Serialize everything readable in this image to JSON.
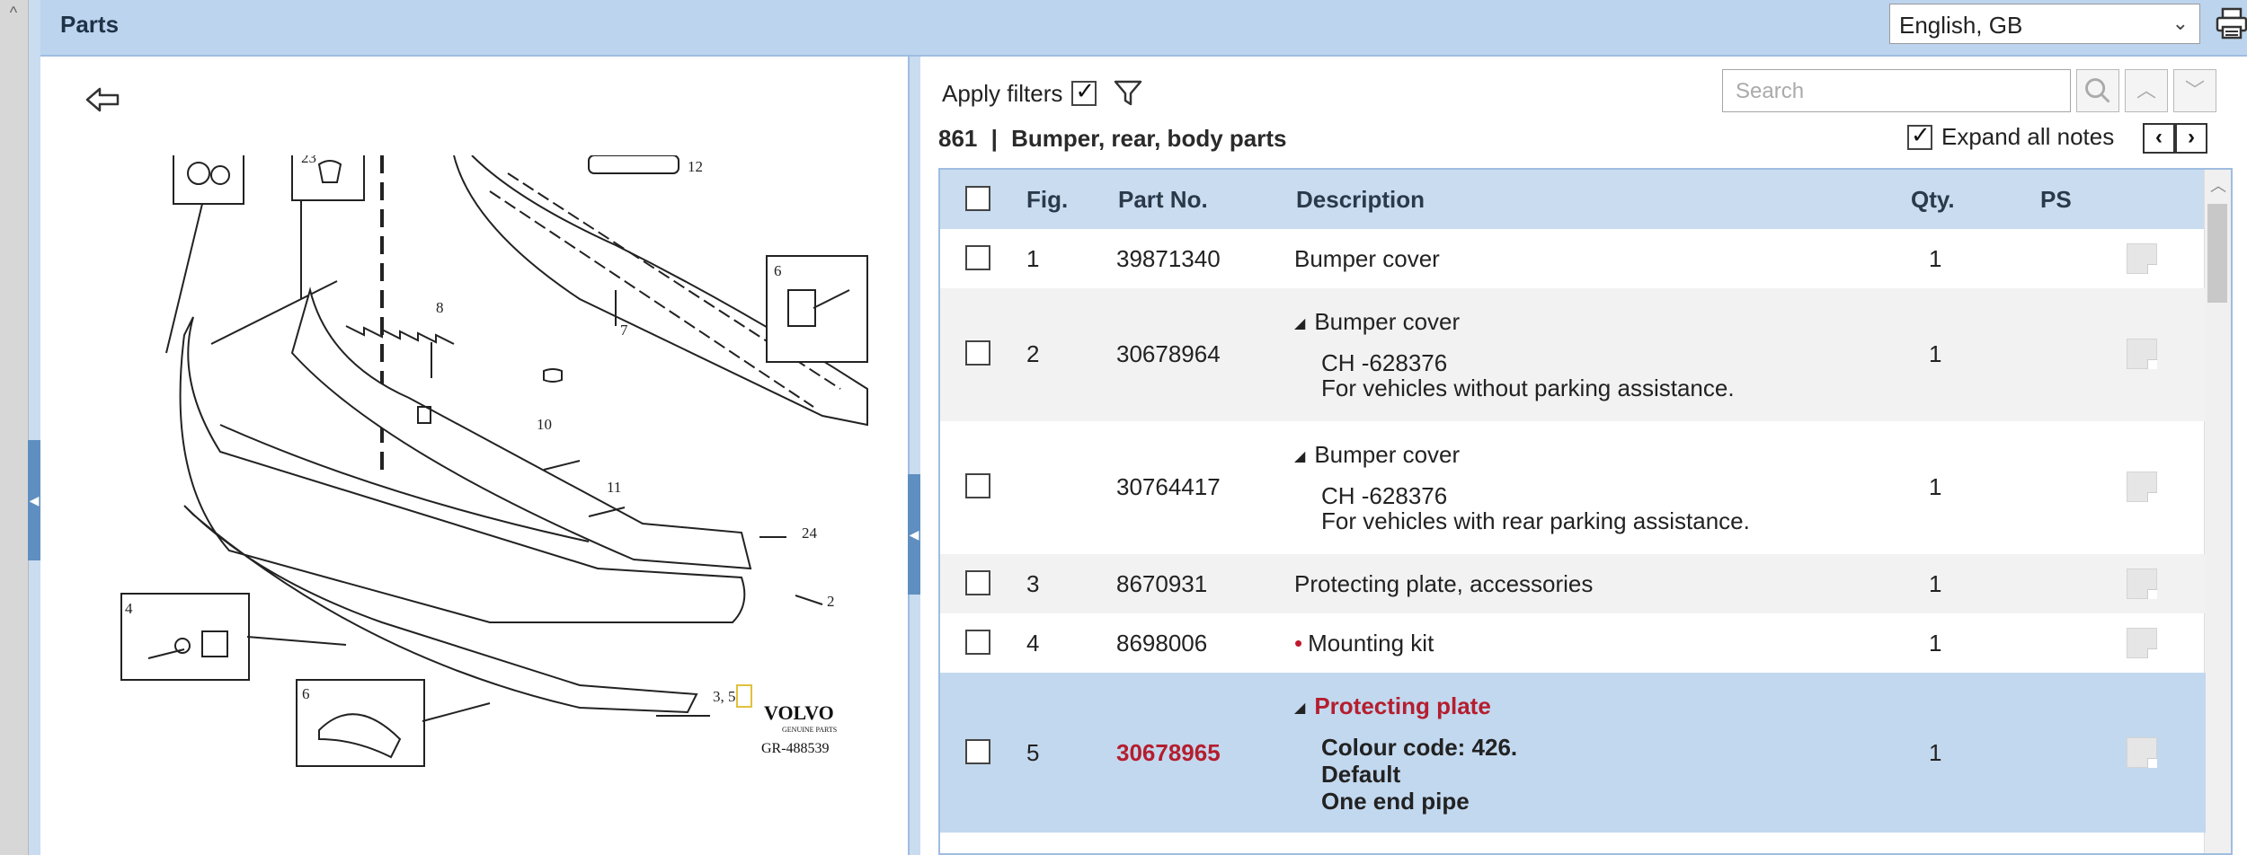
{
  "header": {
    "title": "Parts",
    "language": "English, GB"
  },
  "diagram": {
    "brand": "VOLVO",
    "brand_sub": "GENUINE PARTS",
    "ref": "GR-488539",
    "callouts": [
      "23",
      "12",
      "8",
      "6",
      "7",
      "10",
      "11",
      "24",
      "2",
      "4",
      "6",
      "3, 5"
    ]
  },
  "filters": {
    "apply_label": "Apply filters",
    "search_placeholder": "Search",
    "expand_label": "Expand all notes"
  },
  "breadcrumb": {
    "code": "861",
    "separator": "|",
    "title": "Bumper, rear, body parts"
  },
  "table": {
    "columns": {
      "fig": "Fig.",
      "part_no": "Part No.",
      "description": "Description",
      "qty": "Qty.",
      "ps": "PS"
    },
    "rows": [
      {
        "fig": "1",
        "part_no": "39871340",
        "description": "Bumper cover",
        "qty": "1"
      },
      {
        "fig": "2",
        "part_no": "30678964",
        "description": "Bumper cover",
        "note1": "CH -628376",
        "note2": "For vehicles without parking assistance.",
        "qty": "1"
      },
      {
        "fig": "",
        "part_no": "30764417",
        "description": "Bumper cover",
        "note1": "CH -628376",
        "note2": "For vehicles with rear parking assistance.",
        "qty": "1"
      },
      {
        "fig": "3",
        "part_no": "8670931",
        "description": "Protecting plate, accessories",
        "qty": "1"
      },
      {
        "fig": "4",
        "part_no": "8698006",
        "description": "Mounting kit",
        "qty": "1"
      },
      {
        "fig": "5",
        "part_no": "30678965",
        "description": "Protecting plate",
        "note1": "Colour code: 426.",
        "note2": "Default",
        "note3": "One end pipe",
        "qty": "1"
      }
    ]
  }
}
